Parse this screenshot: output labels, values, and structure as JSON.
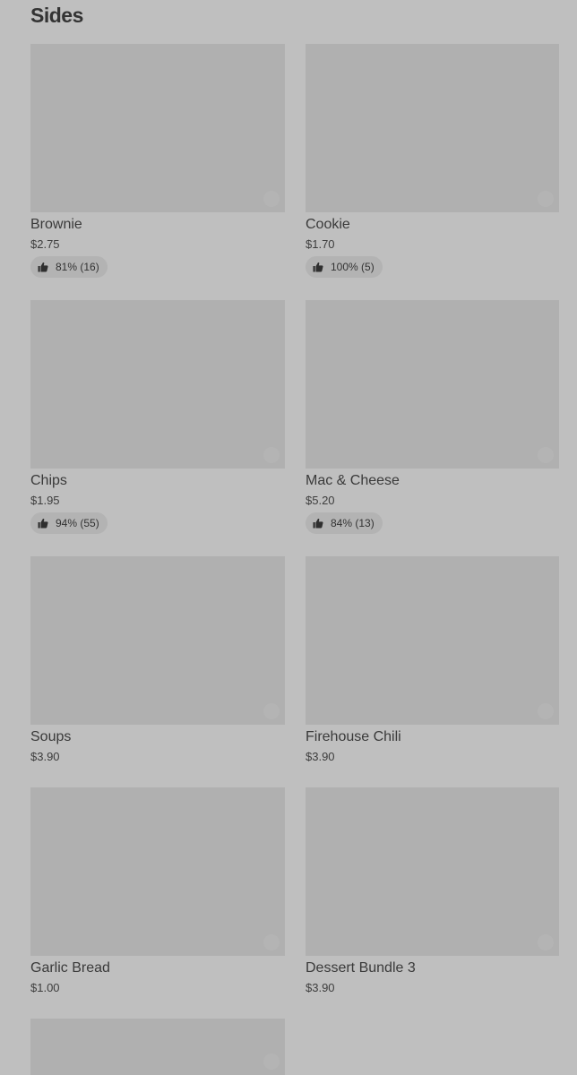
{
  "section": {
    "title": "Sides"
  },
  "items": [
    {
      "name": "Brownie",
      "price": "$2.75",
      "rating": "81% (16)"
    },
    {
      "name": "Cookie",
      "price": "$1.70",
      "rating": "100% (5)"
    },
    {
      "name": "Chips",
      "price": "$1.95",
      "rating": "94% (55)"
    },
    {
      "name": "Mac & Cheese",
      "price": "$5.20",
      "rating": "84% (13)"
    },
    {
      "name": "Soups",
      "price": "$3.90"
    },
    {
      "name": "Firehouse Chili",
      "price": "$3.90"
    },
    {
      "name": "Garlic Bread",
      "price": "$1.00"
    },
    {
      "name": "Dessert Bundle 3",
      "price": "$3.90"
    },
    {
      "name": ""
    }
  ],
  "icons": {
    "rating": "thumbs-up-icon"
  },
  "colors": {
    "background": "#bfbfbf",
    "image_placeholder": "#b0b0b0",
    "pill": "#b3b3b3",
    "text": "#333333"
  }
}
